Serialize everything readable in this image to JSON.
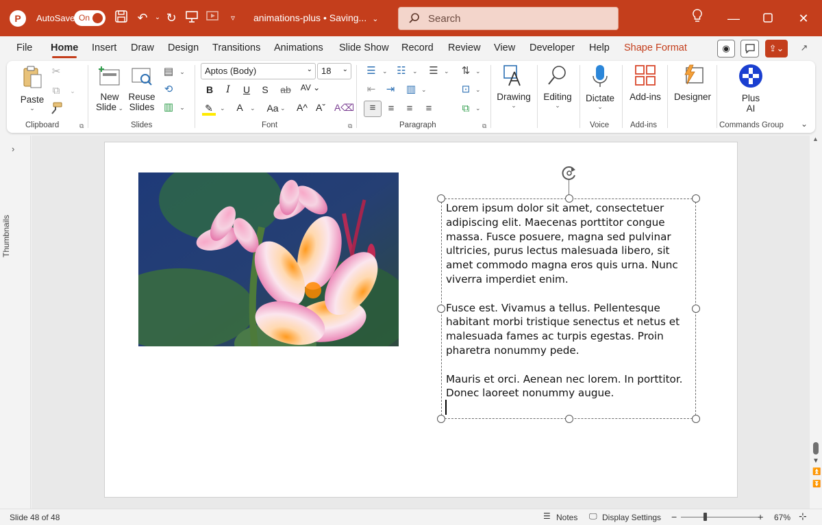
{
  "titlebar": {
    "autosave_label": "AutoSave",
    "autosave_state": "On",
    "doc_title": "animations-plus • Saving...",
    "search_placeholder": "Search"
  },
  "tabs": [
    "File",
    "Home",
    "Insert",
    "Draw",
    "Design",
    "Transitions",
    "Animations",
    "Slide Show",
    "Record",
    "Review",
    "View",
    "Developer",
    "Help",
    "Shape Format"
  ],
  "active_tab": "Home",
  "ribbon": {
    "clipboard": {
      "paste": "Paste",
      "group": "Clipboard"
    },
    "slides": {
      "new_slide_1": "New",
      "new_slide_2": "Slide",
      "reuse_1": "Reuse",
      "reuse_2": "Slides",
      "group": "Slides"
    },
    "font": {
      "family": "Aptos (Body)",
      "size": "18",
      "group": "Font"
    },
    "paragraph": {
      "group": "Paragraph"
    },
    "drawing": {
      "label": "Drawing"
    },
    "editing": {
      "label": "Editing"
    },
    "voice": {
      "dictate": "Dictate",
      "group": "Voice"
    },
    "addins": {
      "label": "Add-ins",
      "group": "Add-ins"
    },
    "designer": {
      "label": "Designer"
    },
    "plusai": {
      "label_1": "Plus",
      "label_2": "AI",
      "group": "Commands Group"
    }
  },
  "sidebar": {
    "thumbnails_label": "Thumbnails"
  },
  "slide": {
    "paragraphs": [
      "Lorem ipsum dolor sit amet, consectetuer adipiscing elit. Maecenas porttitor congue massa. Fusce posuere, magna sed pulvinar ultricies, purus lectus malesuada libero, sit amet commodo magna eros quis urna. Nunc viverra imperdiet enim.",
      "Fusce est. Vivamus a tellus. Pellentesque habitant morbi tristique senectus et netus et malesuada fames ac turpis egestas. Proin pharetra nonummy pede.",
      "Mauris et orci. Aenean nec lorem. In porttitor. Donec laoreet nonummy augue."
    ]
  },
  "status": {
    "slide_counter": "Slide 48 of 48",
    "notes": "Notes",
    "display_settings": "Display Settings",
    "zoom": "67%"
  },
  "colors": {
    "accent": "#c43e1c",
    "plusai_blue": "#1a3fd0"
  }
}
